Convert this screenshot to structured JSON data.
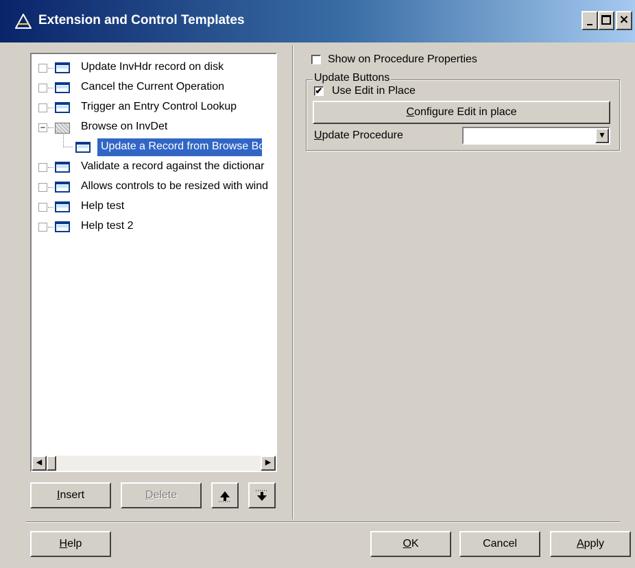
{
  "window": {
    "title": "Extension and Control Templates",
    "controls": {
      "minimize": "_",
      "maximize": "□",
      "close": "×"
    }
  },
  "tree": {
    "items": [
      {
        "label": "Update InvHdr record on disk",
        "icon": "window-icon",
        "expander": "",
        "level": 0
      },
      {
        "label": "Cancel the Current Operation",
        "icon": "window-icon",
        "expander": "",
        "level": 0
      },
      {
        "label": "Trigger an Entry Control Lookup",
        "icon": "window-icon",
        "expander": "",
        "level": 0
      },
      {
        "label": "Browse on InvDet",
        "icon": "folder-icon",
        "expander": "−",
        "level": 0
      },
      {
        "label": "Update a Record from Browse Bo",
        "icon": "window-icon",
        "expander": "",
        "level": 1,
        "selected": true
      },
      {
        "label": "Validate a record against the dictionar",
        "icon": "window-icon",
        "expander": "",
        "level": 0
      },
      {
        "label": "Allows controls to be resized with wind",
        "icon": "window-icon",
        "expander": "",
        "level": 0
      },
      {
        "label": "Help test",
        "icon": "window-icon",
        "expander": "",
        "level": 0
      },
      {
        "label": "Help test 2",
        "icon": "window-icon",
        "expander": "",
        "level": 0
      }
    ],
    "scroll_left": "◀",
    "scroll_right": "▶"
  },
  "left_buttons": {
    "insert": {
      "pre": "",
      "key": "I",
      "post": "nsert"
    },
    "delete": {
      "pre": "",
      "key": "D",
      "post": "elete"
    },
    "move_up_icon": "move-up-icon",
    "move_down_icon": "move-down-icon"
  },
  "right_panel": {
    "show_on_properties": {
      "label": "Show on Procedure Properties",
      "checked": false,
      "mark": ""
    },
    "update_buttons_group": "Update Buttons",
    "use_edit_in_place": {
      "label": "Use Edit in Place",
      "checked": true,
      "mark": "✔"
    },
    "configure_button": {
      "pre": "",
      "key": "C",
      "post": "onfigure Edit in place"
    },
    "update_procedure": {
      "pre": "",
      "key": "U",
      "post": "pdate Procedure",
      "value": "",
      "arrow": "▼"
    }
  },
  "footer": {
    "help": {
      "pre": "",
      "key": "H",
      "post": "elp"
    },
    "ok": {
      "pre": "",
      "key": "O",
      "post": "K"
    },
    "cancel": "Cancel",
    "apply": {
      "pre": "",
      "key": "A",
      "post": "pply"
    }
  },
  "colors": {
    "titlebar_start": "#0a246a",
    "titlebar_end": "#a6caf0",
    "selection": "#3166c5",
    "face": "#d4d0c8"
  }
}
